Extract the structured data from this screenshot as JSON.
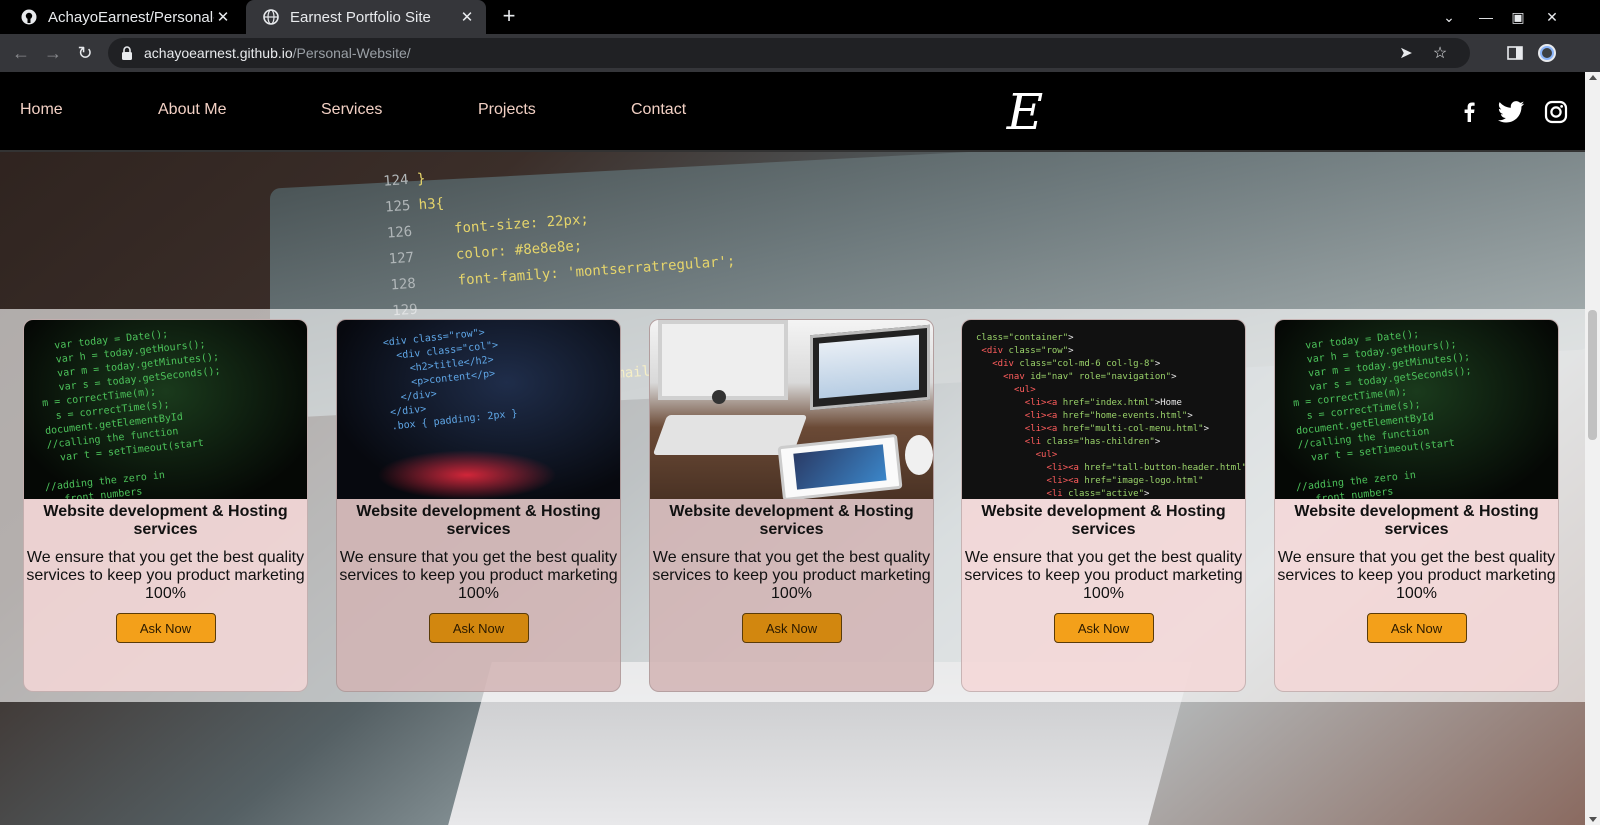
{
  "browser": {
    "tabs": [
      {
        "title": "AchayoEarnest/Personal-",
        "icon": "github-icon",
        "active": false
      },
      {
        "title": "Earnest Portfolio Site",
        "icon": "globe-icon",
        "active": true
      }
    ],
    "url_host": "achayoearnest.github.io",
    "url_path": "/Personal-Website/"
  },
  "nav": {
    "links": [
      "Home",
      "About Me",
      "Services",
      "Projects",
      "Contact"
    ],
    "logo": "E",
    "social": [
      "facebook-icon",
      "twitter-icon",
      "instagram-icon"
    ]
  },
  "cards": [
    {
      "title": "Website development & Hosting services",
      "description": "We ensure that you get the best quality services to keep you product marketing 100%",
      "button": "Ask Now"
    },
    {
      "title": "Website development & Hosting services",
      "description": "We ensure that you get the best quality services to keep you product marketing 100%",
      "button": "Ask Now"
    },
    {
      "title": "Website development & Hosting services",
      "description": "We ensure that you get the best quality services to keep you product marketing 100%",
      "button": "Ask Now"
    },
    {
      "title": "Website development & Hosting services",
      "description": "We ensure that you get the best quality services to keep you product marketing 100%",
      "button": "Ask Now"
    },
    {
      "title": "Website development & Hosting services",
      "description": "We ensure that you get the best quality services to keep you product marketing 100%",
      "button": "Ask Now"
    }
  ],
  "colors": {
    "accent_button": "#f3a01a",
    "nav_link": "#f2d0c4",
    "card_bg": "#f4d7d7"
  }
}
